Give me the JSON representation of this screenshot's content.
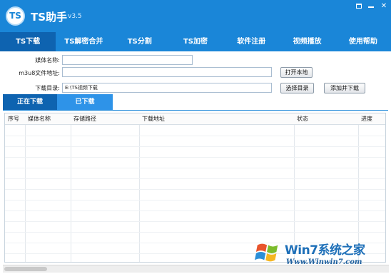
{
  "app": {
    "title": "TS助手",
    "version": "v3.5",
    "logo_text": "TS"
  },
  "menu": [
    "TS下载",
    "TS解密合并",
    "TS分割",
    "TS加密",
    "软件注册",
    "视频播放",
    "使用帮助"
  ],
  "form": {
    "media_name_label": "媒体名称:",
    "media_name_value": "",
    "m3u8_label": "m3u8文件地址:",
    "m3u8_value": "",
    "open_local_button": "打开本地",
    "download_dir_label": "下载目录:",
    "download_dir_value": "E:\\TS视频下载",
    "select_dir_button": "选择目录",
    "add_download_button": "添加并下载"
  },
  "tabs": {
    "downloading": "正在下载",
    "downloaded": "已下载"
  },
  "table": {
    "headers": [
      "序号",
      "媒体名称",
      "存储路径",
      "下载地址",
      "状态",
      "进度"
    ],
    "rows": []
  },
  "watermark": {
    "brand": "Win7系统之家",
    "url": "Www.Winwin7.com"
  },
  "icons": {
    "window_max": "restore-icon",
    "window_min": "minimize-icon",
    "window_close": "close-icon"
  },
  "colors": {
    "primary": "#1a86d8",
    "active": "#0e63b0",
    "tab_secondary": "#2e93e8"
  }
}
